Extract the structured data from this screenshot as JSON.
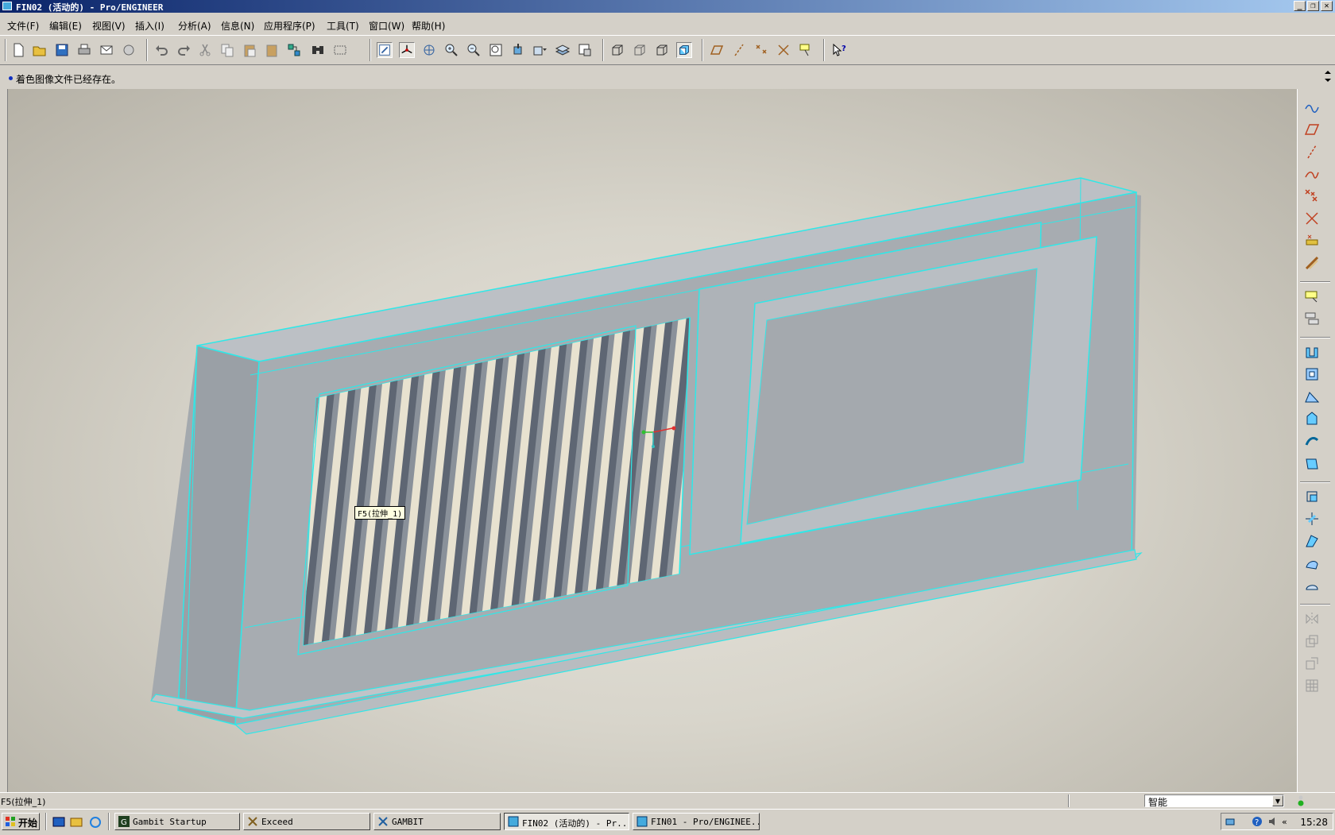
{
  "window": {
    "title": "FIN02 (活动的) - Pro/ENGINEER",
    "buttons": [
      "_",
      "❐",
      "✕"
    ]
  },
  "menu": [
    {
      "label": "文件(F)"
    },
    {
      "label": "编辑(E)"
    },
    {
      "label": "视图(V)"
    },
    {
      "label": "插入(I)"
    },
    {
      "label": "分析(A)"
    },
    {
      "label": "信息(N)"
    },
    {
      "label": "应用程序(P)"
    },
    {
      "label": "工具(T)"
    },
    {
      "label": "窗口(W)"
    },
    {
      "label": "帮助(H)"
    }
  ],
  "toolbar": {
    "icons": [
      "new-icon",
      "open-icon",
      "save-icon",
      "print-icon",
      "email-icon",
      "email-link-icon",
      "undo-icon",
      "redo-icon",
      "cut-icon",
      "copy-icon",
      "paste-icon",
      "paste-special-icon",
      "regenerate-icon",
      "find-icon",
      "select-box-icon",
      "repaint-icon",
      "spin-center-icon",
      "orient-icon",
      "zoom-in-icon",
      "zoom-out-icon",
      "refit-icon",
      "reorient-icon",
      "saved-views-icon",
      "layers-icon",
      "view-manager-icon",
      "wireframe-icon",
      "hidden-line-icon",
      "no-hidden-icon",
      "shading-icon",
      "datum-planes-icon",
      "datum-axes-icon",
      "datum-points-icon",
      "datum-csys-icon",
      "annotation-icon",
      "context-help-icon"
    ]
  },
  "message": {
    "text": "着色图像文件已经存在。"
  },
  "viewport": {
    "feature_label": "F5(拉伸_1)",
    "colors": {
      "edge": "#2ee8e8",
      "body": "#a7acb1",
      "face_light": "#b8bdc2",
      "fin_dark": "#5e6673",
      "fin_light": "#e8e2d0"
    }
  },
  "right_toolbar": {
    "icons": [
      "sketch-tool-icon",
      "datum-plane-icon",
      "datum-axis-icon",
      "datum-curve-icon",
      "datum-point-icon",
      "datum-csys-tool-icon",
      "analysis-icon",
      "datum-ref-icon",
      "hole-icon",
      "shell-icon",
      "rib-icon",
      "draft-icon",
      "round-icon",
      "chamfer-icon",
      "extrude-icon",
      "revolve-icon",
      "sweep-icon",
      "blend-icon",
      "style-icon",
      "mirror-icon",
      "merge-icon",
      "trim-icon",
      "pattern-icon"
    ]
  },
  "status": {
    "text": "F5(拉伸_1)",
    "filter_value": "智能"
  },
  "taskbar": {
    "start": "开始",
    "tasks": [
      {
        "label": "Gambit Startup"
      },
      {
        "label": "Exceed"
      },
      {
        "label": "GAMBIT"
      },
      {
        "label": "FIN02 (活动的) - Pr..."
      },
      {
        "label": "FIN01 - Pro/ENGINEE..."
      }
    ],
    "clock": "15:28"
  }
}
